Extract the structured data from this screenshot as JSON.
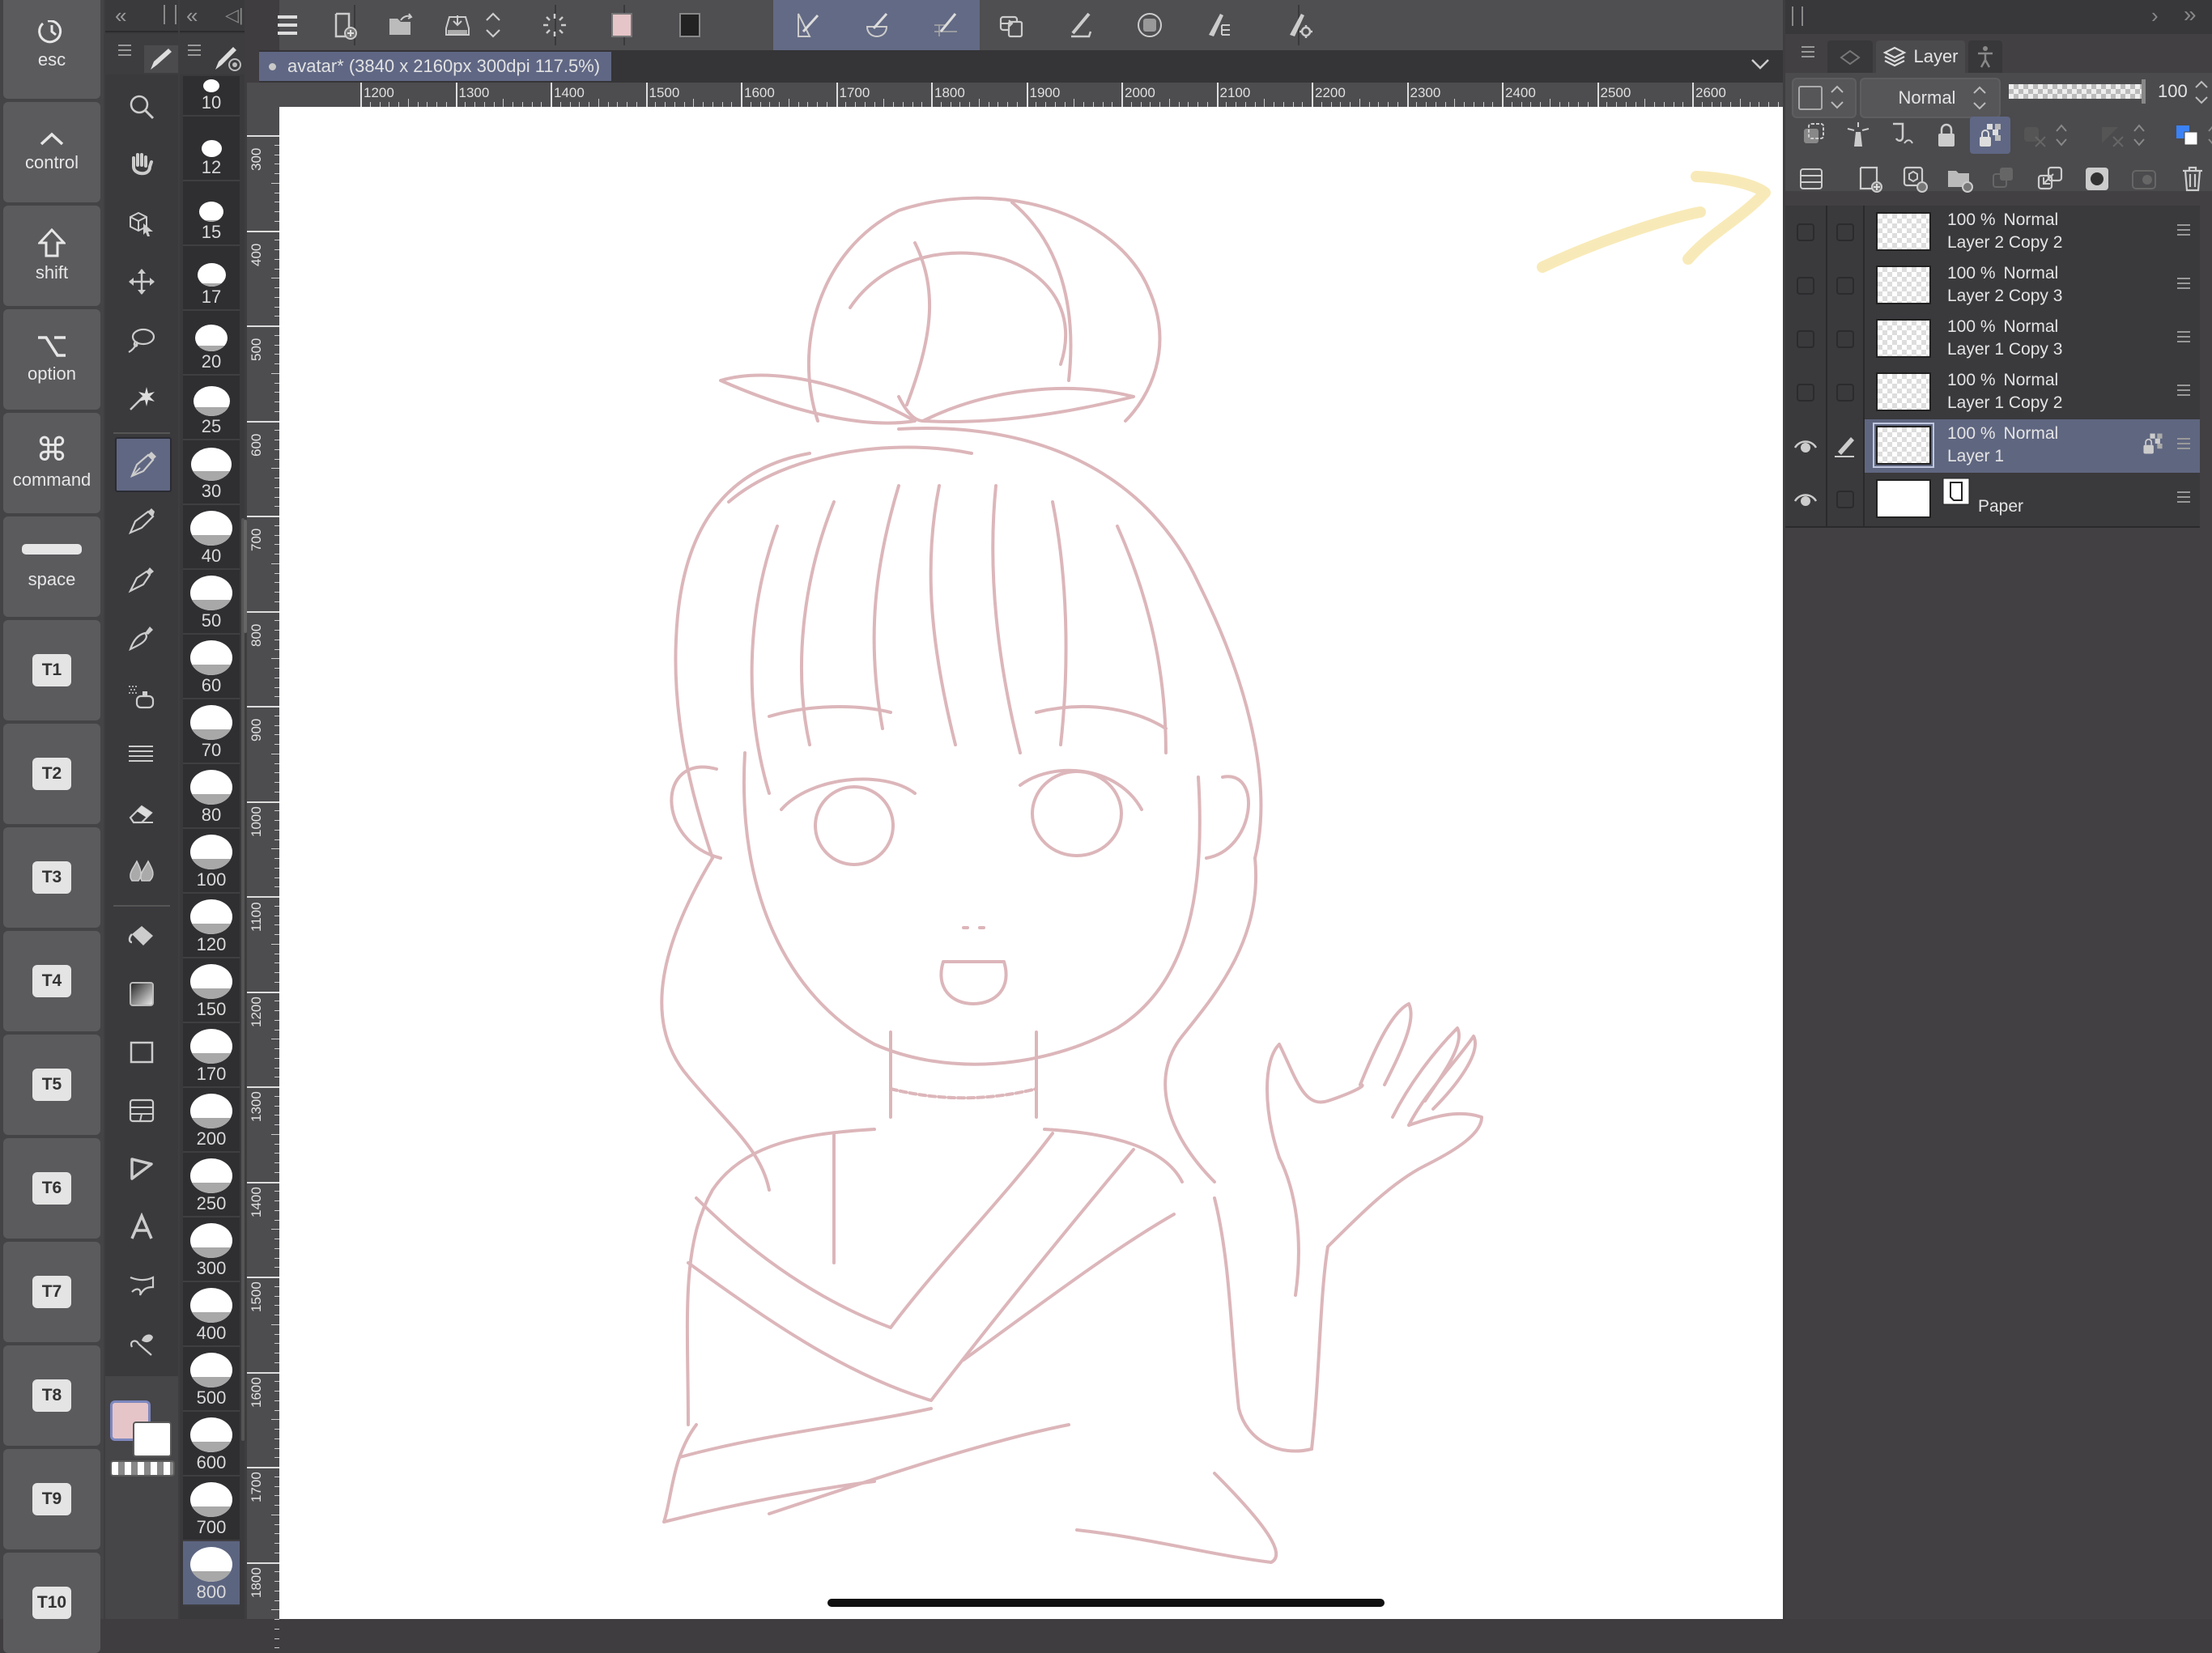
{
  "modifier_keys": [
    {
      "label": "esc",
      "icon": "undo-circle-icon"
    },
    {
      "label": "control",
      "icon": "caret-up-icon"
    },
    {
      "label": "shift",
      "icon": "shift-arrow-icon"
    },
    {
      "label": "option",
      "icon": "option-key-icon"
    },
    {
      "label": "command",
      "icon": "command-key-icon"
    },
    {
      "label": "space",
      "icon": "space-bar-icon"
    }
  ],
  "shortcut_keys": [
    "T1",
    "T2",
    "T3",
    "T4",
    "T5",
    "T6",
    "T7",
    "T8",
    "T9",
    "T10"
  ],
  "tools": [
    {
      "name": "zoom-tool",
      "icon": "magnifier-icon"
    },
    {
      "name": "hand-tool",
      "icon": "hand-icon"
    },
    {
      "name": "operation-tool",
      "icon": "object-cursor-icon"
    },
    {
      "name": "move-layer-tool",
      "icon": "move-arrows-icon"
    },
    {
      "name": "lasso-tool",
      "icon": "lasso-icon"
    },
    {
      "name": "auto-select-tool",
      "icon": "magic-wand-icon"
    },
    {
      "name": "pen-tool",
      "icon": "pen-nib-icon",
      "active": true
    },
    {
      "name": "pencil-tool",
      "icon": "pencil-icon"
    },
    {
      "name": "brush-tool",
      "icon": "brush-icon"
    },
    {
      "name": "decoration-brush-tool",
      "icon": "ink-brush-icon"
    },
    {
      "name": "airbrush-tool",
      "icon": "airbrush-icon"
    },
    {
      "name": "decoration-tool",
      "icon": "lines-icon"
    },
    {
      "name": "eraser-tool",
      "icon": "eraser-icon"
    },
    {
      "name": "blend-tool",
      "icon": "blend-drops-icon"
    },
    {
      "name": "fill-tool",
      "icon": "paint-bucket-icon"
    },
    {
      "name": "gradient-tool",
      "icon": "gradient-icon"
    },
    {
      "name": "figure-tool",
      "icon": "rectangle-icon"
    },
    {
      "name": "frame-border-tool",
      "icon": "frame-border-icon"
    },
    {
      "name": "ruler-tool",
      "icon": "ruler-triangle-icon"
    },
    {
      "name": "text-tool",
      "icon": "text-a-icon"
    },
    {
      "name": "balloon-tool",
      "icon": "balloon-icon"
    },
    {
      "name": "correct-line-tool",
      "icon": "correct-line-icon"
    }
  ],
  "colors": {
    "main": "#e6c5c8",
    "sub": "#ffffff",
    "accent": "#5f6784",
    "sketch": "#dcb6ba",
    "annotation": "#f8eab8"
  },
  "brush_sizes": [
    {
      "value": "10",
      "fill": 0.0
    },
    {
      "value": "12",
      "fill": 0.0
    },
    {
      "value": "15",
      "fill": 0.1
    },
    {
      "value": "17",
      "fill": 0.15
    },
    {
      "value": "20",
      "fill": 0.2
    },
    {
      "value": "25",
      "fill": 0.3
    },
    {
      "value": "30",
      "fill": 0.3
    },
    {
      "value": "40",
      "fill": 0.3
    },
    {
      "value": "50",
      "fill": 0.3
    },
    {
      "value": "60",
      "fill": 0.3
    },
    {
      "value": "70",
      "fill": 0.3
    },
    {
      "value": "80",
      "fill": 0.3
    },
    {
      "value": "100",
      "fill": 0.3
    },
    {
      "value": "120",
      "fill": 0.3
    },
    {
      "value": "150",
      "fill": 0.3
    },
    {
      "value": "170",
      "fill": 0.3
    },
    {
      "value": "200",
      "fill": 0.3
    },
    {
      "value": "250",
      "fill": 0.3
    },
    {
      "value": "300",
      "fill": 0.3
    },
    {
      "value": "400",
      "fill": 0.3
    },
    {
      "value": "500",
      "fill": 0.3
    },
    {
      "value": "600",
      "fill": 0.3
    },
    {
      "value": "700",
      "fill": 0.3
    },
    {
      "value": "800",
      "fill": 0.3,
      "active": true
    }
  ],
  "toolbar": {
    "buttons": [
      {
        "name": "menu-button",
        "icon": "hamburger-icon"
      },
      {
        "name": "new-canvas-button",
        "icon": "new-document-icon"
      },
      {
        "name": "open-button",
        "icon": "open-folder-icon"
      },
      {
        "name": "save-button",
        "icon": "save-tray-icon"
      },
      {
        "name": "save-options-button",
        "icon": "up-down-chevron-icon"
      },
      {
        "name": "loading-button",
        "icon": "spinner-icon"
      },
      {
        "name": "main-color-button",
        "icon": "color-swatch-pink-icon"
      },
      {
        "name": "sub-color-button",
        "icon": "color-swatch-black-icon"
      },
      {
        "name": "snap-to-ruler-button",
        "icon": "snap-ruler-icon",
        "selected": true
      },
      {
        "name": "snap-to-special-ruler-button",
        "icon": "snap-special-icon",
        "selected": true
      },
      {
        "name": "snap-to-grid-button",
        "icon": "snap-grid-icon",
        "selected": true
      },
      {
        "name": "transform-button",
        "icon": "transform-icon"
      },
      {
        "name": "stabilization-button",
        "icon": "pen-stroke-icon"
      },
      {
        "name": "mask-button",
        "icon": "mask-circle-icon"
      },
      {
        "name": "pen-settings-button",
        "icon": "pen-list-icon"
      },
      {
        "name": "pen-pressure-button",
        "icon": "pen-gear-icon"
      }
    ]
  },
  "document": {
    "tab_title": "avatar* (3840 x 2160px 300dpi 117.5%)"
  },
  "ruler": {
    "horizontal": [
      "1200",
      "1300",
      "1400",
      "1500",
      "1600",
      "1700",
      "1800",
      "1900",
      "2000",
      "2100",
      "2200",
      "2300",
      "2400",
      "2500",
      "2600"
    ],
    "vertical": [
      "300",
      "400",
      "500",
      "600",
      "700",
      "800",
      "900",
      "1000",
      "1100",
      "1200",
      "1300",
      "1400",
      "1500",
      "1600",
      "1700",
      "1800"
    ]
  },
  "layer_panel": {
    "tab_label": "Layer",
    "blend_mode": "Normal",
    "opacity": "100",
    "opacity_fraction": 1.0,
    "layers": [
      {
        "opacity": "100 %",
        "mode": "Normal",
        "name": "Layer 2 Copy 2",
        "visible": false,
        "editing": false,
        "selected": false
      },
      {
        "opacity": "100 %",
        "mode": "Normal",
        "name": "Layer 2 Copy 3",
        "visible": false,
        "editing": false,
        "selected": false
      },
      {
        "opacity": "100 %",
        "mode": "Normal",
        "name": "Layer 1 Copy 3",
        "visible": false,
        "editing": false,
        "selected": false
      },
      {
        "opacity": "100 %",
        "mode": "Normal",
        "name": "Layer 1 Copy 2",
        "visible": false,
        "editing": false,
        "selected": false
      },
      {
        "opacity": "100 %",
        "mode": "Normal",
        "name": "Layer 1",
        "visible": true,
        "editing": true,
        "selected": true,
        "lock_transparent": true
      },
      {
        "opacity": "",
        "mode": "",
        "name": "Paper",
        "visible": true,
        "editing": false,
        "selected": false,
        "paper": true
      }
    ]
  }
}
